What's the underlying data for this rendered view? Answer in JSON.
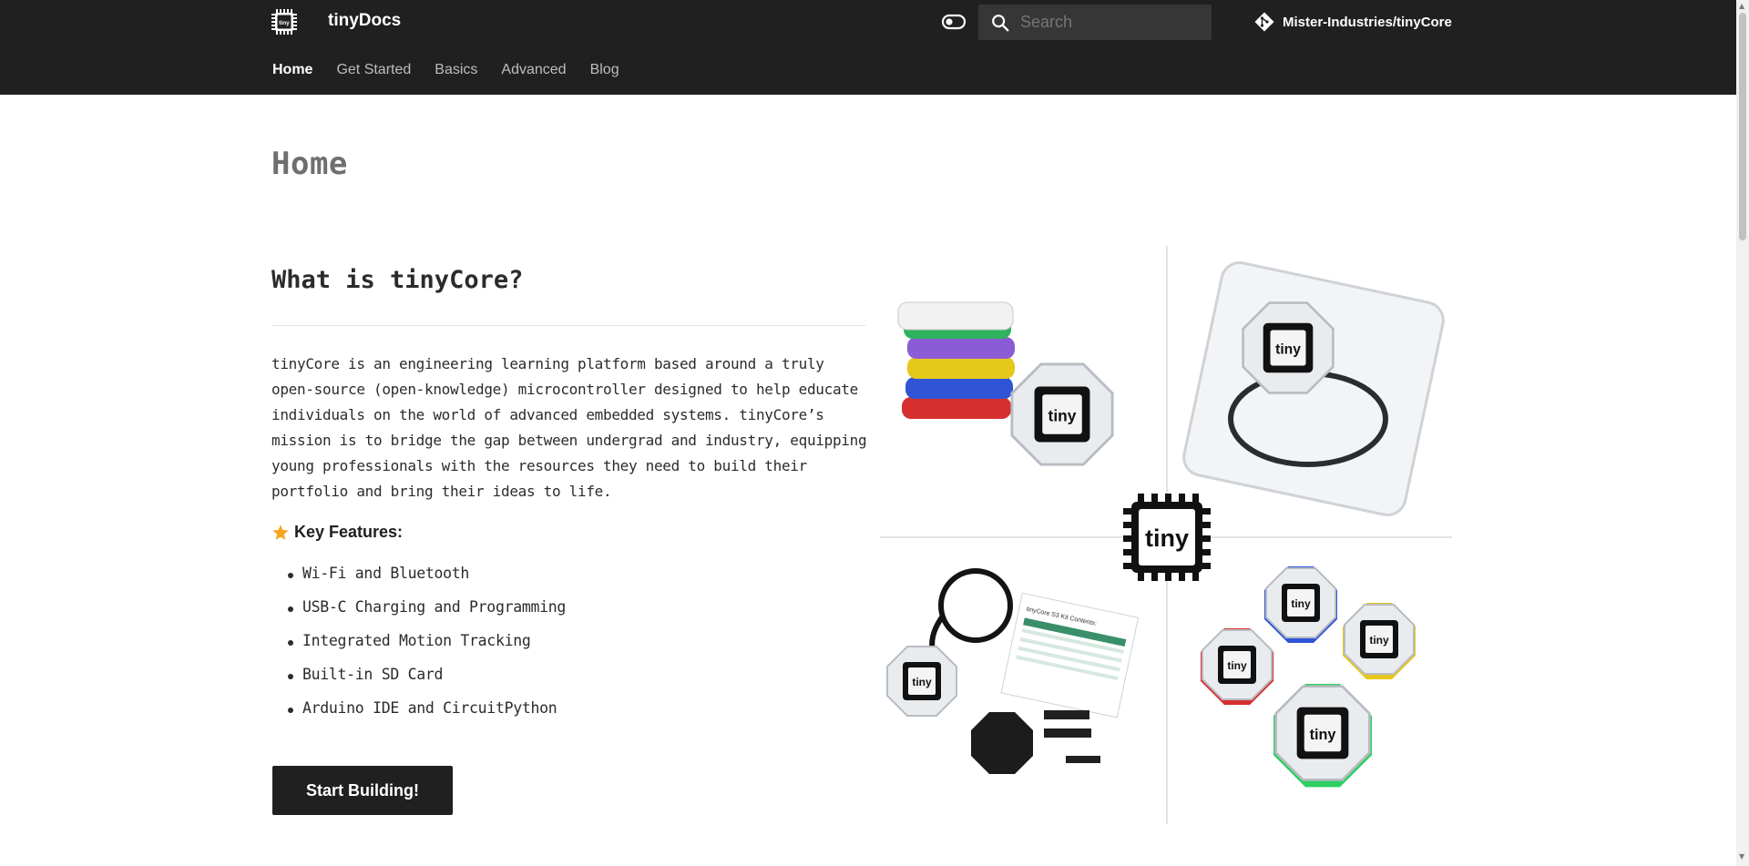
{
  "header": {
    "site_title": "tinyDocs",
    "logo_text": "tiny",
    "search": {
      "placeholder": "Search"
    },
    "repo": {
      "name": "Mister-Industries/tinyCore"
    },
    "tabs": [
      {
        "label": "Home",
        "active": true
      },
      {
        "label": "Get Started",
        "active": false
      },
      {
        "label": "Basics",
        "active": false
      },
      {
        "label": "Advanced",
        "active": false
      },
      {
        "label": "Blog",
        "active": false
      }
    ],
    "colors": {
      "background": "#202020",
      "text": "#ffffff",
      "inactive_tab": "#bdbdbd"
    }
  },
  "main": {
    "page_title": "Home",
    "section_title": "What is tinyCore?",
    "intro": "tinyCore is an engineering learning platform based around a truly open-source (open-knowledge) microcontroller designed to help educate individuals on the world of advanced embedded systems. tinyCore’s mission is to bridge the gap between undergrad and industry, equipping young professionals with the resources they need to build their portfolio and bring their ideas to life.",
    "features_label": "Key Features:",
    "features": [
      "Wi-Fi and Bluetooth",
      "USB-C Charging and Programming",
      "Integrated Motion Tracking",
      "Built-in SD Card",
      "Arduino IDE and CircuitPython"
    ],
    "cta_label": "Start Building!",
    "hero": {
      "center_logo_text": "tiny",
      "module_label": "tiny",
      "kit_card_title": "tinyCore S3 Kit Contents:"
    }
  },
  "icons": {
    "logo": "chip-icon",
    "palette": "toggle-icon",
    "search": "search-icon",
    "repo": "git-icon",
    "features": "star-icon"
  }
}
